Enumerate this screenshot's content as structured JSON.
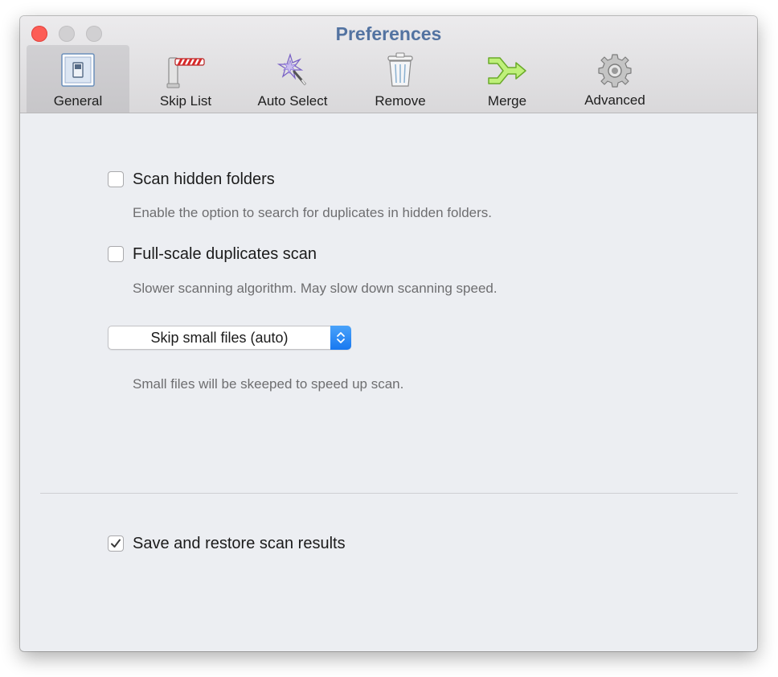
{
  "window": {
    "title": "Preferences"
  },
  "toolbar": {
    "items": [
      {
        "label": "General",
        "icon": "toggle-switch-icon",
        "selected": true
      },
      {
        "label": "Skip List",
        "icon": "barrier-gate-icon",
        "selected": false
      },
      {
        "label": "Auto Select",
        "icon": "magic-wand-icon",
        "selected": false
      },
      {
        "label": "Remove",
        "icon": "trash-can-icon",
        "selected": false
      },
      {
        "label": "Merge",
        "icon": "merge-arrow-icon",
        "selected": false
      },
      {
        "label": "Advanced",
        "icon": "gear-icon",
        "selected": false
      }
    ]
  },
  "general": {
    "scan_hidden": {
      "label": "Scan hidden folders",
      "checked": false,
      "description": "Enable the option to search for duplicates in hidden folders."
    },
    "full_scale": {
      "label": "Full-scale duplicates scan",
      "checked": false,
      "description": "Slower scanning algorithm. May slow down scanning speed."
    },
    "skip_small": {
      "value": "Skip small files (auto)",
      "description": "Small files will be skeeped to speed up scan."
    },
    "save_restore": {
      "label": "Save and restore scan results",
      "checked": true
    }
  },
  "colors": {
    "title": "#5373a1",
    "accent": "#1878f0",
    "close": "#fd5d56"
  }
}
